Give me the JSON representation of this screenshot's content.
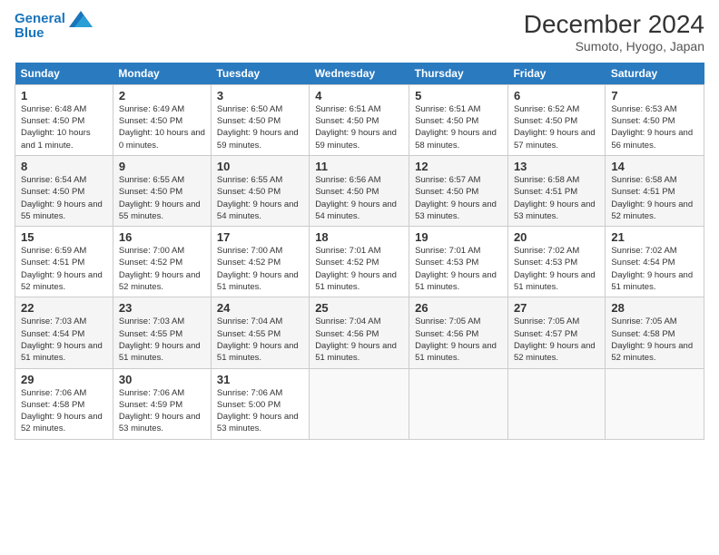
{
  "header": {
    "logo_line1": "General",
    "logo_line2": "Blue",
    "title": "December 2024",
    "subtitle": "Sumoto, Hyogo, Japan"
  },
  "weekdays": [
    "Sunday",
    "Monday",
    "Tuesday",
    "Wednesday",
    "Thursday",
    "Friday",
    "Saturday"
  ],
  "weeks": [
    [
      {
        "day": "1",
        "sunrise": "Sunrise: 6:48 AM",
        "sunset": "Sunset: 4:50 PM",
        "daylight": "Daylight: 10 hours and 1 minute."
      },
      {
        "day": "2",
        "sunrise": "Sunrise: 6:49 AM",
        "sunset": "Sunset: 4:50 PM",
        "daylight": "Daylight: 10 hours and 0 minutes."
      },
      {
        "day": "3",
        "sunrise": "Sunrise: 6:50 AM",
        "sunset": "Sunset: 4:50 PM",
        "daylight": "Daylight: 9 hours and 59 minutes."
      },
      {
        "day": "4",
        "sunrise": "Sunrise: 6:51 AM",
        "sunset": "Sunset: 4:50 PM",
        "daylight": "Daylight: 9 hours and 59 minutes."
      },
      {
        "day": "5",
        "sunrise": "Sunrise: 6:51 AM",
        "sunset": "Sunset: 4:50 PM",
        "daylight": "Daylight: 9 hours and 58 minutes."
      },
      {
        "day": "6",
        "sunrise": "Sunrise: 6:52 AM",
        "sunset": "Sunset: 4:50 PM",
        "daylight": "Daylight: 9 hours and 57 minutes."
      },
      {
        "day": "7",
        "sunrise": "Sunrise: 6:53 AM",
        "sunset": "Sunset: 4:50 PM",
        "daylight": "Daylight: 9 hours and 56 minutes."
      }
    ],
    [
      {
        "day": "8",
        "sunrise": "Sunrise: 6:54 AM",
        "sunset": "Sunset: 4:50 PM",
        "daylight": "Daylight: 9 hours and 55 minutes."
      },
      {
        "day": "9",
        "sunrise": "Sunrise: 6:55 AM",
        "sunset": "Sunset: 4:50 PM",
        "daylight": "Daylight: 9 hours and 55 minutes."
      },
      {
        "day": "10",
        "sunrise": "Sunrise: 6:55 AM",
        "sunset": "Sunset: 4:50 PM",
        "daylight": "Daylight: 9 hours and 54 minutes."
      },
      {
        "day": "11",
        "sunrise": "Sunrise: 6:56 AM",
        "sunset": "Sunset: 4:50 PM",
        "daylight": "Daylight: 9 hours and 54 minutes."
      },
      {
        "day": "12",
        "sunrise": "Sunrise: 6:57 AM",
        "sunset": "Sunset: 4:50 PM",
        "daylight": "Daylight: 9 hours and 53 minutes."
      },
      {
        "day": "13",
        "sunrise": "Sunrise: 6:58 AM",
        "sunset": "Sunset: 4:51 PM",
        "daylight": "Daylight: 9 hours and 53 minutes."
      },
      {
        "day": "14",
        "sunrise": "Sunrise: 6:58 AM",
        "sunset": "Sunset: 4:51 PM",
        "daylight": "Daylight: 9 hours and 52 minutes."
      }
    ],
    [
      {
        "day": "15",
        "sunrise": "Sunrise: 6:59 AM",
        "sunset": "Sunset: 4:51 PM",
        "daylight": "Daylight: 9 hours and 52 minutes."
      },
      {
        "day": "16",
        "sunrise": "Sunrise: 7:00 AM",
        "sunset": "Sunset: 4:52 PM",
        "daylight": "Daylight: 9 hours and 52 minutes."
      },
      {
        "day": "17",
        "sunrise": "Sunrise: 7:00 AM",
        "sunset": "Sunset: 4:52 PM",
        "daylight": "Daylight: 9 hours and 51 minutes."
      },
      {
        "day": "18",
        "sunrise": "Sunrise: 7:01 AM",
        "sunset": "Sunset: 4:52 PM",
        "daylight": "Daylight: 9 hours and 51 minutes."
      },
      {
        "day": "19",
        "sunrise": "Sunrise: 7:01 AM",
        "sunset": "Sunset: 4:53 PM",
        "daylight": "Daylight: 9 hours and 51 minutes."
      },
      {
        "day": "20",
        "sunrise": "Sunrise: 7:02 AM",
        "sunset": "Sunset: 4:53 PM",
        "daylight": "Daylight: 9 hours and 51 minutes."
      },
      {
        "day": "21",
        "sunrise": "Sunrise: 7:02 AM",
        "sunset": "Sunset: 4:54 PM",
        "daylight": "Daylight: 9 hours and 51 minutes."
      }
    ],
    [
      {
        "day": "22",
        "sunrise": "Sunrise: 7:03 AM",
        "sunset": "Sunset: 4:54 PM",
        "daylight": "Daylight: 9 hours and 51 minutes."
      },
      {
        "day": "23",
        "sunrise": "Sunrise: 7:03 AM",
        "sunset": "Sunset: 4:55 PM",
        "daylight": "Daylight: 9 hours and 51 minutes."
      },
      {
        "day": "24",
        "sunrise": "Sunrise: 7:04 AM",
        "sunset": "Sunset: 4:55 PM",
        "daylight": "Daylight: 9 hours and 51 minutes."
      },
      {
        "day": "25",
        "sunrise": "Sunrise: 7:04 AM",
        "sunset": "Sunset: 4:56 PM",
        "daylight": "Daylight: 9 hours and 51 minutes."
      },
      {
        "day": "26",
        "sunrise": "Sunrise: 7:05 AM",
        "sunset": "Sunset: 4:56 PM",
        "daylight": "Daylight: 9 hours and 51 minutes."
      },
      {
        "day": "27",
        "sunrise": "Sunrise: 7:05 AM",
        "sunset": "Sunset: 4:57 PM",
        "daylight": "Daylight: 9 hours and 52 minutes."
      },
      {
        "day": "28",
        "sunrise": "Sunrise: 7:05 AM",
        "sunset": "Sunset: 4:58 PM",
        "daylight": "Daylight: 9 hours and 52 minutes."
      }
    ],
    [
      {
        "day": "29",
        "sunrise": "Sunrise: 7:06 AM",
        "sunset": "Sunset: 4:58 PM",
        "daylight": "Daylight: 9 hours and 52 minutes."
      },
      {
        "day": "30",
        "sunrise": "Sunrise: 7:06 AM",
        "sunset": "Sunset: 4:59 PM",
        "daylight": "Daylight: 9 hours and 53 minutes."
      },
      {
        "day": "31",
        "sunrise": "Sunrise: 7:06 AM",
        "sunset": "Sunset: 5:00 PM",
        "daylight": "Daylight: 9 hours and 53 minutes."
      },
      null,
      null,
      null,
      null
    ]
  ]
}
